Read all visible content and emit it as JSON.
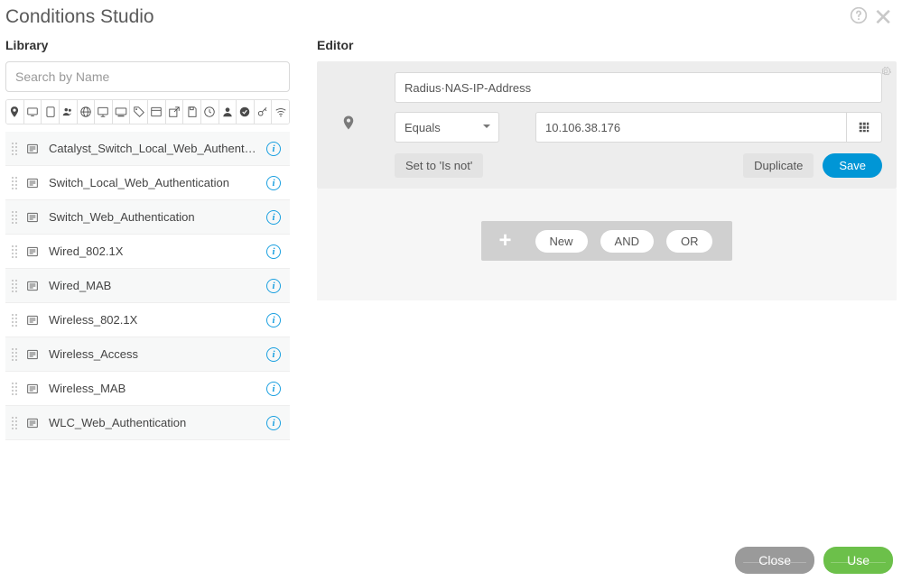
{
  "header": {
    "title": "Conditions Studio"
  },
  "library": {
    "label": "Library",
    "search_placeholder": "Search by Name",
    "filter_icons": [
      "pin",
      "screen",
      "tablet",
      "group",
      "globe",
      "monitor",
      "desktop",
      "tag",
      "window",
      "popout",
      "save",
      "clock",
      "person",
      "check-badge",
      "key",
      "wifi"
    ],
    "items": [
      {
        "label": "Catalyst_Switch_Local_Web_Authentication"
      },
      {
        "label": "Switch_Local_Web_Authentication"
      },
      {
        "label": "Switch_Web_Authentication"
      },
      {
        "label": "Wired_802.1X"
      },
      {
        "label": "Wired_MAB"
      },
      {
        "label": "Wireless_802.1X"
      },
      {
        "label": "Wireless_Access"
      },
      {
        "label": "Wireless_MAB"
      },
      {
        "label": "WLC_Web_Authentication"
      }
    ]
  },
  "editor": {
    "label": "Editor",
    "attribute": "Radius·NAS-IP-Address",
    "operator": "Equals",
    "value": "10.106.38.176",
    "set_not_label": "Set to 'Is not'",
    "duplicate_label": "Duplicate",
    "save_label": "Save",
    "add_new": "New",
    "add_and": "AND",
    "add_or": "OR"
  },
  "footer": {
    "close": "Close",
    "use": "Use"
  }
}
